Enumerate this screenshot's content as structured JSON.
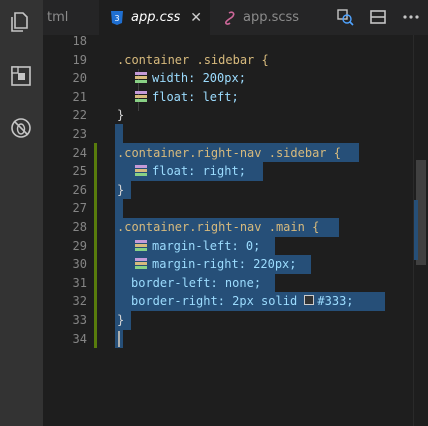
{
  "tabs": [
    {
      "label": "tml",
      "active": false
    },
    {
      "label": "app.css",
      "active": true,
      "close": "✕"
    },
    {
      "label": "app.scss",
      "active": false
    }
  ],
  "icons": {
    "activity": [
      "files-icon",
      "extensions-icon",
      "debug-icon"
    ],
    "toolbar": [
      "compare-icon",
      "split-editor-icon",
      "more-icon"
    ]
  },
  "lines": [
    {
      "n": "18",
      "t": ""
    },
    {
      "n": "19",
      "t": ".container .sidebar {"
    },
    {
      "n": "20",
      "t": "width: 200px;"
    },
    {
      "n": "21",
      "t": "float: left;"
    },
    {
      "n": "22",
      "t": "}"
    },
    {
      "n": "23",
      "t": ""
    },
    {
      "n": "24",
      "t": ".container.right-nav .sidebar {"
    },
    {
      "n": "25",
      "t": "float: right;"
    },
    {
      "n": "26",
      "t": "}"
    },
    {
      "n": "27",
      "t": ""
    },
    {
      "n": "28",
      "t": ".container.right-nav .main {"
    },
    {
      "n": "29",
      "t": "margin-left: 0;"
    },
    {
      "n": "30",
      "t": "margin-right: 220px;"
    },
    {
      "n": "31",
      "t": "border-left: none;"
    },
    {
      "n": "32",
      "t": "border-right: 2px solid #333;"
    },
    {
      "n": "33",
      "t": "}"
    },
    {
      "n": "34",
      "t": ""
    }
  ],
  "colors": {
    "selection": "#264f78",
    "git_added": "#587c0c",
    "css_icon": "#1f6fd1",
    "scss_icon": "#cd6799"
  }
}
